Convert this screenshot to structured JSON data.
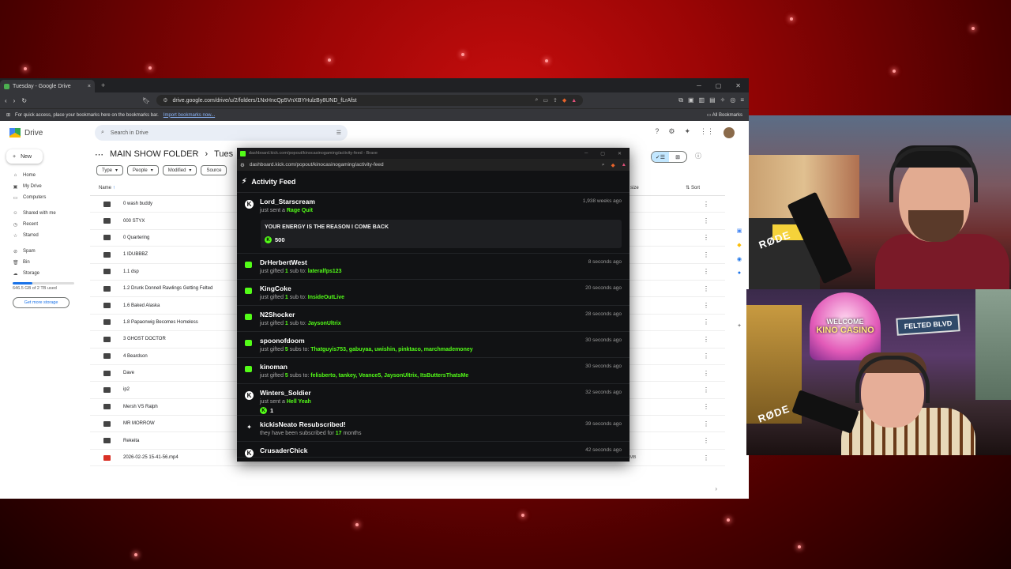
{
  "browser": {
    "tab_title": "Tuesday - Google Drive",
    "tab_close": "×",
    "new_tab": "+",
    "url": "drive.google.com/drive/u/2/folders/1NxHncQp5VnXBYHulzBy8UND_fLrAfst",
    "bookmarks_hint": "For quick access, place your bookmarks here on the bookmarks bar.",
    "import_bookmarks": "Import bookmarks now...",
    "all_bookmarks": "All Bookmarks"
  },
  "drive": {
    "logo_text": "Drive",
    "search_placeholder": "Search in Drive",
    "new_label": "New",
    "sidebar": [
      {
        "label": "Home"
      },
      {
        "label": "My Drive"
      },
      {
        "label": "Computers"
      },
      {
        "label": "Shared with me"
      },
      {
        "label": "Recent"
      },
      {
        "label": "Starred"
      },
      {
        "label": "Spam"
      },
      {
        "label": "Bin"
      },
      {
        "label": "Storage"
      }
    ],
    "storage_used": "646.5 GB of 2 TB used",
    "storage_fraction": 0.32,
    "get_more_storage": "Get more storage",
    "breadcrumb": [
      "MAIN SHOW FOLDER",
      "Tues"
    ],
    "filters": [
      "Type",
      "People",
      "Modified",
      "Source"
    ],
    "col_name": "Name",
    "col_size": "size",
    "col_sort": "Sort",
    "files": [
      {
        "name": "0 wash buddy",
        "type": "folder"
      },
      {
        "name": "000 STYX",
        "type": "folder"
      },
      {
        "name": "0 Quartering",
        "type": "folder"
      },
      {
        "name": "1 IDUBBBZ",
        "type": "folder"
      },
      {
        "name": "1.1 dsp",
        "type": "folder"
      },
      {
        "name": "1.2 Drunk Donnell Rawlings Getting Felted",
        "type": "folder"
      },
      {
        "name": "1.6 Baked Alaska",
        "type": "folder"
      },
      {
        "name": "1.8 Papaonwig Becomes Homeless",
        "type": "folder"
      },
      {
        "name": "3 GHOST DOCTOR",
        "type": "folder"
      },
      {
        "name": "4 Beardson",
        "type": "folder"
      },
      {
        "name": "Dave",
        "type": "folder"
      },
      {
        "name": "ip2",
        "type": "folder"
      },
      {
        "name": "Mersh VS Ralph",
        "type": "folder"
      },
      {
        "name": "MR MORROW",
        "type": "folder"
      },
      {
        "name": "Rekeita",
        "type": "folder"
      },
      {
        "name": "2026-02-25 15-41-56.mp4",
        "type": "video",
        "size": "7.8 MB"
      }
    ]
  },
  "kick": {
    "window_title": "dashboard.kick.com/popout/kinocasinogaming/activity-feed - Brave",
    "url": "dashboard.kick.com/popout/kinocasinogaming/activity-feed",
    "feed_title": "Activity Feed",
    "events": [
      {
        "user": "Lord_Starscream",
        "text": "just sent a",
        "highlight": "Rage Quit",
        "time": "1,938 weeks ago",
        "icon": "kick-coin-icon",
        "message": "YOUR ENERGY IS THE REASON I COME BACK",
        "amount": "500"
      },
      {
        "user": "DrHerbertWest",
        "text": "just gifted",
        "count": "1",
        "mid": "sub to:",
        "highlight": "lateralfps123",
        "time": "8 seconds ago",
        "icon": "gift-icon"
      },
      {
        "user": "KingCoke",
        "text": "just gifted",
        "count": "1",
        "mid": "sub to:",
        "highlight": "InsideOutLive",
        "time": "20 seconds ago",
        "icon": "gift-icon"
      },
      {
        "user": "N2Shocker",
        "text": "just gifted",
        "count": "1",
        "mid": "sub to:",
        "highlight": "JaysonUltrix",
        "time": "28 seconds ago",
        "icon": "gift-icon"
      },
      {
        "user": "spoonofdoom",
        "text": "just gifted",
        "count": "5",
        "mid": "subs to:",
        "highlight": "Thatguyis753, gabuyaa, uwishin, pinktaco, marchmademoney",
        "time": "30 seconds ago",
        "icon": "gift-icon"
      },
      {
        "user": "kinoman",
        "text": "just gifted",
        "count": "5",
        "mid": "subs to:",
        "highlight": "felisberto, tankey, Veance5, JaysonUltrix, ItsButtersThatsMe",
        "time": "30 seconds ago",
        "icon": "gift-icon"
      },
      {
        "user": "Winters_Soldier",
        "text": "just sent a",
        "highlight": "Hell Yeah",
        "time": "32 seconds ago",
        "icon": "kick-coin-icon",
        "amount": "1"
      },
      {
        "user": "kickisNeato Resubscribed!",
        "text": "they have been subscribed for",
        "highlight": "17",
        "suffix": "months",
        "time": "39 seconds ago",
        "icon": "sparkle-icon"
      },
      {
        "user": "CrusaderChick",
        "time": "42 seconds ago",
        "icon": "kick-coin-icon"
      }
    ]
  },
  "overlay": {
    "welcome": "WELCOME",
    "casino": "KINO CASINO",
    "felted": "FELTED BLVD",
    "rode": "RØDE"
  },
  "colors": {
    "kick_green": "#53fc18",
    "drive_blue": "#1a73e8",
    "background_red": "#9a0505"
  }
}
